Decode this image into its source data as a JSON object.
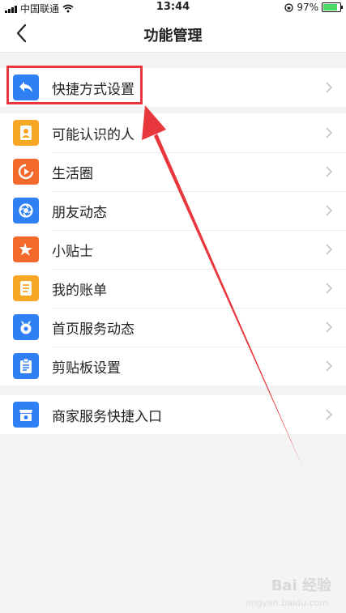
{
  "status_bar": {
    "carrier": "中国联通",
    "time": "13:44",
    "battery": "97%",
    "battery_level": 0.97
  },
  "nav": {
    "title": "功能管理",
    "back_icon": "chevron-left-icon"
  },
  "group1": [
    {
      "label": "快捷方式设置",
      "icon": "reply-arrow-icon",
      "color": "#2f7ff5"
    }
  ],
  "group2": [
    {
      "label": "可能认识的人",
      "icon": "contact-card-icon",
      "color": "#f6a623"
    },
    {
      "label": "生活圈",
      "icon": "play-circle-icon",
      "color": "#f46a2a"
    },
    {
      "label": "朋友动态",
      "icon": "aperture-icon",
      "color": "#2f7ff5"
    },
    {
      "label": "小贴士",
      "icon": "star-burst-icon",
      "color": "#f46a2a"
    },
    {
      "label": "我的账单",
      "icon": "bill-icon",
      "color": "#f6a623"
    },
    {
      "label": "首页服务动态",
      "icon": "bell-eye-icon",
      "color": "#2f7ff5"
    },
    {
      "label": "剪贴板设置",
      "icon": "clipboard-icon",
      "color": "#2f7ff5"
    }
  ],
  "group3": [
    {
      "label": "商家服务快捷入口",
      "icon": "storefront-icon",
      "color": "#2f7ff5"
    }
  ],
  "watermark": {
    "text": "Bai 经验",
    "sub": "jingyan.baidu.com"
  },
  "colors": {
    "annotation_red": "#e8383d"
  }
}
